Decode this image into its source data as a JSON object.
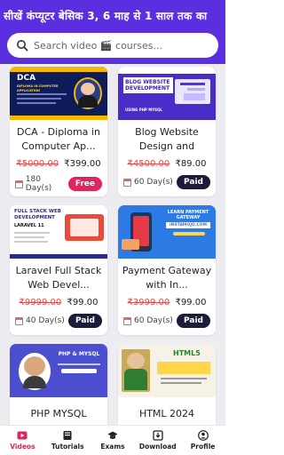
{
  "header": {
    "marquee": "सीखें कंप्यूटर बेसिक 3, 6 माह से 1 साल तक का",
    "search_placeholder": "Search video 🎬 courses...",
    "bg_color": "#5b2fe0"
  },
  "courses": [
    {
      "title": "DCA - Diploma in Computer Ap...",
      "old_price": "₹5000.00",
      "price": "₹399.00",
      "duration": "180 Day(s)",
      "badge": "Free",
      "badge_color": "#e0245e",
      "thumb": {
        "heading": "DCA",
        "sub": "DIPLOMA IN COMPUTER APPLICATION"
      }
    },
    {
      "title": "Blog Website Design and deve...",
      "old_price": "₹4500.00",
      "price": "₹89.00",
      "duration": "60 Day(s)",
      "badge": "Paid",
      "badge_color": "#1c1c3a",
      "thumb": {
        "heading": "BLOG WEBSITE DEVELOPMENT",
        "sub": "USING PHP MYSQL"
      }
    },
    {
      "title": "Laravel Full Stack Web Devel...",
      "old_price": "₹9999.00",
      "price": "₹99.00",
      "duration": "40 Day(s)",
      "badge": "Paid",
      "badge_color": "#1c1c3a",
      "thumb": {
        "heading": "FULL STACK WEB DEVELOPMENT",
        "sub": "LARAVEL 11"
      }
    },
    {
      "title": "Payment Gateway with In...",
      "old_price": "₹3999.00",
      "price": "₹99.00",
      "duration": "60 Day(s)",
      "badge": "Paid",
      "badge_color": "#1c1c3a",
      "thumb": {
        "heading": "LEARN PAYMENT GATEWAY",
        "sub": "INSTAMOJO.COM"
      }
    },
    {
      "title": "PHP MYSQL",
      "thumb": {
        "heading": "PHP & MYSQL"
      }
    },
    {
      "title": "HTML 2024",
      "thumb": {
        "heading": "HTML5"
      }
    }
  ],
  "nav": {
    "items": [
      {
        "label": "Videos",
        "icon": "play-icon",
        "active": true
      },
      {
        "label": "Tutorials",
        "icon": "book-icon",
        "active": false
      },
      {
        "label": "Exams",
        "icon": "graduation-cap-icon",
        "active": false
      },
      {
        "label": "Download",
        "icon": "download-icon",
        "active": false
      },
      {
        "label": "Profile",
        "icon": "user-icon",
        "active": false
      }
    ],
    "active_color": "#e0245e"
  }
}
